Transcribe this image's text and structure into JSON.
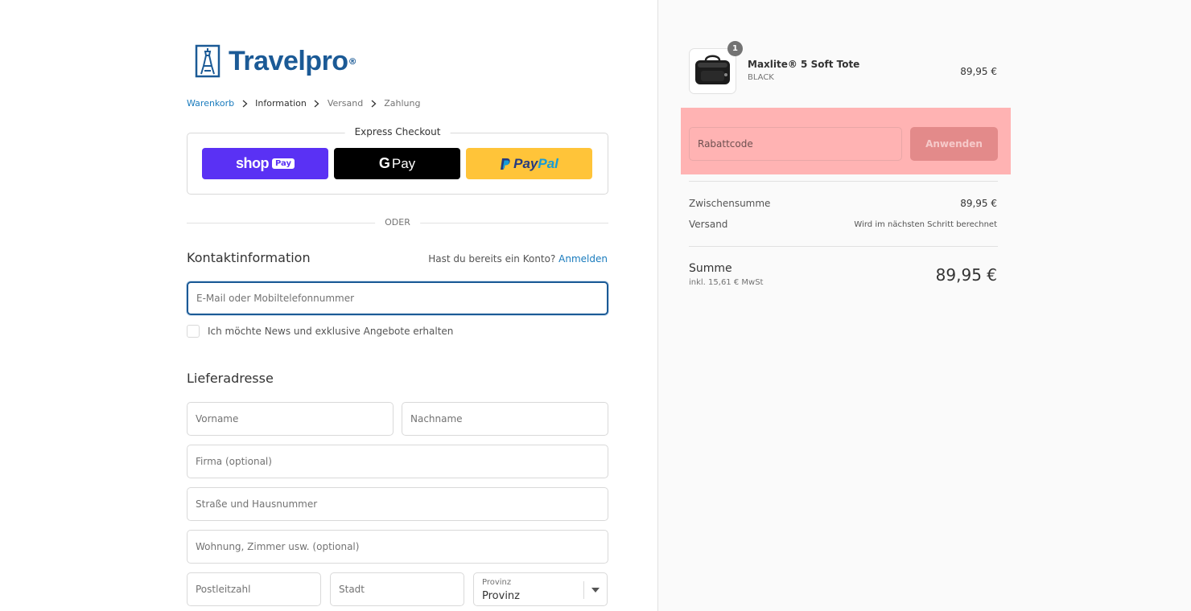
{
  "brand": {
    "name": "Travelpro",
    "registered_mark": "®"
  },
  "breadcrumb": [
    {
      "label": "Warenkorb"
    },
    {
      "label": "Information"
    },
    {
      "label": "Versand"
    },
    {
      "label": "Zahlung"
    }
  ],
  "express": {
    "title": "Express Checkout",
    "shop_pay": {
      "word": "shop",
      "pill": "Pay"
    },
    "google_pay": {
      "g": "G",
      "pay": "Pay"
    },
    "paypal": {
      "pay": "Pay",
      "pal": "Pal"
    }
  },
  "divider_text": "ODER",
  "contact": {
    "title": "Kontaktinformation",
    "login_prompt": "Hast du bereits ein Konto?",
    "login_link": "Anmelden",
    "email_placeholder": "E-Mail oder Mobiltelefonnummer",
    "newsletter_label": "Ich möchte News und exklusive Angebote erhalten"
  },
  "shipping": {
    "title": "Lieferadresse",
    "first_name_placeholder": "Vorname",
    "last_name_placeholder": "Nachname",
    "company_placeholder": "Firma (optional)",
    "street_placeholder": "Straße und Hausnummer",
    "apartment_placeholder": "Wohnung, Zimmer usw. (optional)",
    "zip_placeholder": "Postleitzahl",
    "city_placeholder": "Stadt",
    "province_label": "Provinz",
    "province_value": "Provinz"
  },
  "order": {
    "item": {
      "quantity": "1",
      "name": "Maxlite® 5 Soft Tote",
      "variant": "BLACK",
      "price": "89,95 €"
    },
    "discount_placeholder": "Rabattcode",
    "apply_label": "Anwenden",
    "subtotal_label": "Zwischensumme",
    "subtotal_value": "89,95 €",
    "shipping_label": "Versand",
    "shipping_value": "Wird im nächsten Schritt berechnet",
    "total_label": "Summe",
    "tax_note": "inkl. 15,61 € MwSt",
    "total_value": "89,95 €"
  },
  "colors": {
    "brand_blue": "#1b5a96",
    "link_blue": "#197bbd",
    "shop_pay_purple": "#5a31f4",
    "paypal_yellow": "#ffc439",
    "highlight": "#ffb3b3"
  },
  "icons": {
    "logo": "eiffel-tower-logo-icon",
    "breadcrumb_separator": "chevron-right-icon",
    "select_arrow": "chevron-down-icon",
    "product": "tote-bag-icon"
  }
}
